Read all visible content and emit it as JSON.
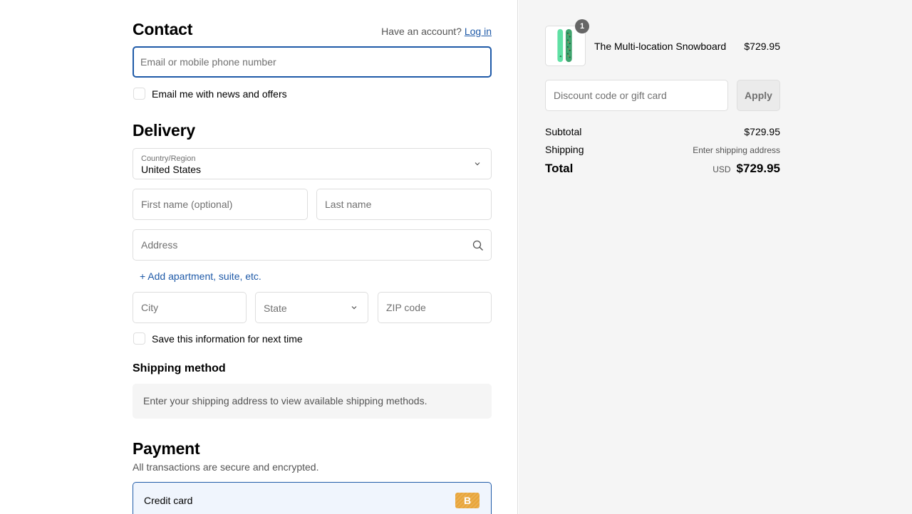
{
  "contact": {
    "title": "Contact",
    "account_prompt": "Have an account?",
    "login_link": "Log in",
    "email_placeholder": "Email or mobile phone number",
    "newsletter_label": "Email me with news and offers"
  },
  "delivery": {
    "title": "Delivery",
    "country_label": "Country/Region",
    "country_value": "United States",
    "first_name_placeholder": "First name (optional)",
    "last_name_placeholder": "Last name",
    "address_placeholder": "Address",
    "add_apartment_link": "+ Add apartment, suite, etc.",
    "city_placeholder": "City",
    "state_placeholder": "State",
    "zip_placeholder": "ZIP code",
    "save_info_label": "Save this information for next time"
  },
  "shipping_method": {
    "title": "Shipping method",
    "notice": "Enter your shipping address to view available shipping methods."
  },
  "payment": {
    "title": "Payment",
    "subtitle": "All transactions are secure and encrypted.",
    "option_label": "Credit card",
    "option_badge": "B"
  },
  "summary": {
    "product": {
      "name": "The Multi-location Snowboard",
      "price": "$729.95",
      "quantity": "1"
    },
    "discount_placeholder": "Discount code or gift card",
    "apply_label": "Apply",
    "subtotal_label": "Subtotal",
    "subtotal_value": "$729.95",
    "shipping_label": "Shipping",
    "shipping_value": "Enter shipping address",
    "total_label": "Total",
    "total_currency": "USD",
    "total_value": "$729.95"
  },
  "colors": {
    "accent": "#1f5aa8",
    "badge": "#e8a53a",
    "summary_bg": "#f5f5f5"
  }
}
